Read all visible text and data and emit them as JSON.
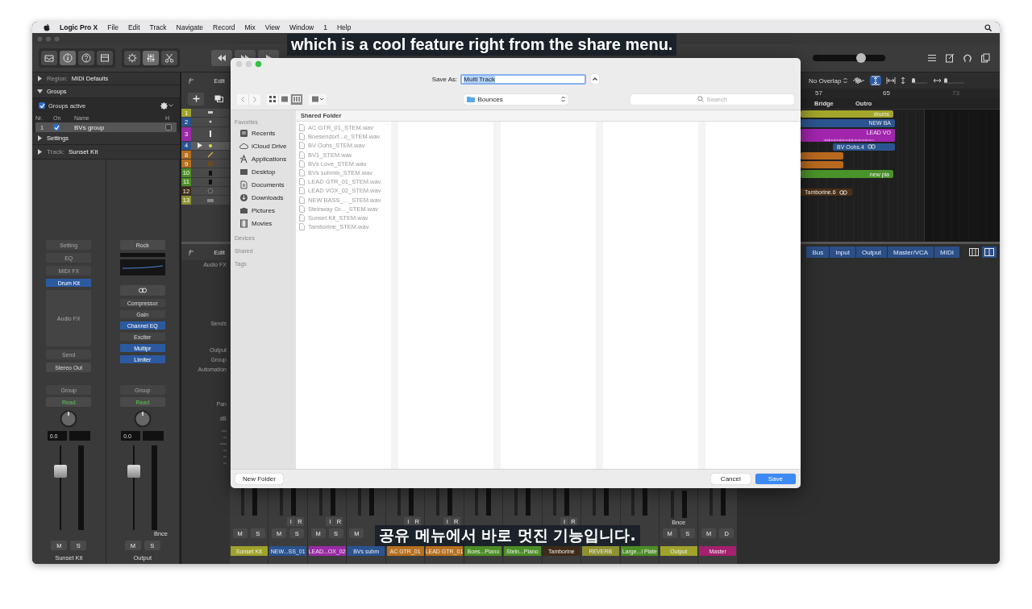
{
  "menu_bar": {
    "app": "Logic Pro X",
    "items": [
      "File",
      "Edit",
      "Track",
      "Navigate",
      "Record",
      "Mix",
      "View",
      "Window",
      "1",
      "Help"
    ]
  },
  "toolbar": {
    "master_volume": {
      "level": 0.67
    }
  },
  "inspector": {
    "region": {
      "label": "Region:",
      "value": "MIDI Defaults",
      "expanded": false
    },
    "groups": {
      "title": "Groups",
      "expanded": true,
      "active_label": "Groups active",
      "active": true,
      "columns": [
        "Nr.",
        "On",
        "Name",
        "H"
      ],
      "rows": [
        {
          "nr": "1",
          "on": true,
          "name": "BVs group",
          "hidden": false
        }
      ]
    },
    "settings": {
      "title": "Settings",
      "expanded": false
    },
    "track": {
      "label": "Track:",
      "value": "Sunset Kit",
      "expanded": false
    },
    "channel_strips": [
      {
        "slots": [
          {
            "kind": "slot",
            "text": "Setting",
            "disabled": true
          },
          {
            "kind": "slot",
            "text": "EQ",
            "disabled": true
          },
          {
            "kind": "slot",
            "text": "MIDI FX",
            "disabled": true
          },
          {
            "kind": "insert",
            "text": "Drum Kit",
            "on": true
          },
          {
            "kind": "area",
            "text": "Audio FX"
          },
          {
            "kind": "slot",
            "text": "Send",
            "disabled": true
          },
          {
            "kind": "slot",
            "text": "Stereo Out",
            "disabled": false
          }
        ],
        "group": "Group",
        "automation": "Read",
        "pan_value": "0.0",
        "fader": {
          "level": 0.7
        },
        "buttons": [
          "M",
          "S"
        ],
        "name": "Sunset Kit"
      },
      {
        "slots": [
          {
            "kind": "slot",
            "text": "Rock",
            "disabled": false
          },
          {
            "kind": "eq-display"
          },
          {
            "kind": "link"
          },
          {
            "kind": "insert",
            "text": "Compressor",
            "on": false
          },
          {
            "kind": "insert",
            "text": "Gain",
            "on": false
          },
          {
            "kind": "insert",
            "text": "Channel EQ",
            "on": true
          },
          {
            "kind": "insert",
            "text": "Exciter",
            "on": false
          },
          {
            "kind": "insert",
            "text": "Multipr",
            "on": true
          },
          {
            "kind": "insert",
            "text": "Limiter",
            "on": true
          }
        ],
        "group": "Group",
        "automation": "Read",
        "pan_value": "0.0",
        "fader": {
          "level": 0.7
        },
        "bounce": "Bnce",
        "buttons": [
          "M",
          "S"
        ],
        "name": "Output"
      }
    ]
  },
  "tracks": {
    "edit_label": "Edit",
    "rows": [
      {
        "number": "1",
        "color": "#9fa32a",
        "selected": false,
        "region": {
          "name": "drums",
          "color": "#a3a62b"
        }
      },
      {
        "number": "2",
        "color": "#2a5391",
        "selected": false,
        "region": {
          "name": "NEW BA",
          "color": "#2b5590"
        }
      },
      {
        "number": "3",
        "color": "#9b2aa6",
        "selected": false,
        "region": {
          "name": "LEAD VO",
          "color": "#a125ad"
        }
      },
      {
        "number": "4",
        "color": "#2a5391",
        "selected": true,
        "region": {
          "name": "BV Oohs.4",
          "color": "#2b5590"
        }
      },
      {
        "number": "8",
        "color": "#b8701f",
        "selected": false,
        "region": {
          "color": "#b8691f"
        }
      },
      {
        "number": "9",
        "color": "#b8701f",
        "selected": false,
        "region": {
          "color": "#b8691f"
        }
      },
      {
        "number": "10",
        "color": "#4c8f26",
        "selected": false,
        "region": {
          "name": "new pia",
          "color": "#4a922a"
        }
      },
      {
        "number": "11",
        "color": "#4c8f26",
        "selected": false
      },
      {
        "number": "12",
        "color": "#3e2a18",
        "selected": false,
        "region": {
          "name": "Tamborine.6",
          "color": "#4a3016"
        }
      },
      {
        "number": "13",
        "color": "#8d9130",
        "selected": false
      }
    ]
  },
  "arrange": {
    "drag_mode": "No Overlap",
    "ruler": [
      "57",
      "65",
      "73"
    ],
    "markers": [
      "Bridge",
      "Outro"
    ]
  },
  "mixer": {
    "edit_label": "Edit",
    "labels": [
      "Audio FX",
      "Sends",
      "Output",
      "Group",
      "Automation",
      "Pan",
      "dB"
    ],
    "filters": [
      {
        "label": "Bus",
        "on": true
      },
      {
        "label": "Input",
        "on": true
      },
      {
        "label": "Output",
        "on": true
      },
      {
        "label": "Master/VCA",
        "on": true
      },
      {
        "label": "MIDI",
        "on": true
      }
    ],
    "strips": [
      {
        "name": "Sunset Kit",
        "color": "#9fa32a",
        "buttons": [
          "M",
          "S"
        ]
      },
      {
        "name": "NEW...SS_01",
        "color": "#2a5391",
        "input": [
          "I",
          "R"
        ],
        "buttons": [
          "M",
          "S"
        ]
      },
      {
        "name": "LEAD...OX_02",
        "color": "#9b2aa6",
        "input": [
          "I",
          "R"
        ],
        "buttons": [
          "M",
          "S"
        ]
      },
      {
        "name": "BVs subm",
        "color": "#2a5391",
        "buttons": [
          "M"
        ]
      },
      {
        "name": "AC GTR_01",
        "color": "#b8701f",
        "input": [
          "I",
          "R"
        ]
      },
      {
        "name": "LEAD GTR_01",
        "color": "#b8701f",
        "input": [
          "I",
          "R"
        ]
      },
      {
        "name": "Boes...Piano",
        "color": "#4c8f26"
      },
      {
        "name": "Stein...Piano",
        "color": "#4c8f26"
      },
      {
        "name": "Tamborine",
        "color": "#3e2a18",
        "input": [
          "I",
          "R"
        ]
      },
      {
        "name": "REVERB",
        "color": "#8d9130"
      },
      {
        "name": "Large...l Plate",
        "color": "#4c8f26"
      },
      {
        "name": "Output",
        "color": "#9fa32a",
        "bounce": "Bnce",
        "buttons": [
          "M",
          "S"
        ]
      },
      {
        "name": "Master",
        "color": "#a5206f",
        "buttons": [
          "M",
          "D"
        ]
      }
    ]
  },
  "dialog": {
    "save_as_label": "Save As:",
    "file_name": "Multi Track",
    "location": "Bounces",
    "search_placeholder": "Search",
    "sidebar": [
      {
        "title": "Favorites",
        "items": [
          {
            "label": "Recents",
            "kind": "recents"
          },
          {
            "label": "iCloud Drive",
            "kind": "cloud"
          },
          {
            "label": "Applications",
            "kind": "applications"
          },
          {
            "label": "Desktop",
            "kind": "desktop"
          },
          {
            "label": "Documents",
            "kind": "documents"
          },
          {
            "label": "Downloads",
            "kind": "downloads"
          },
          {
            "label": "Pictures",
            "kind": "pictures"
          },
          {
            "label": "Movies",
            "kind": "movies"
          }
        ]
      },
      {
        "title": "Devices"
      },
      {
        "title": "Shared"
      },
      {
        "title": "Tags"
      }
    ],
    "column_header": "Shared Folder",
    "files": [
      {
        "name": "AC GTR_01_STEM.wav",
        "disabled": true
      },
      {
        "name": "Boesendorf...o_STEM.wav",
        "disabled": true
      },
      {
        "name": "BV Oohs_STEM.wav",
        "disabled": true
      },
      {
        "name": "BV1_STEM.wav",
        "disabled": true
      },
      {
        "name": "BVs Love_STEM.wav",
        "disabled": true
      },
      {
        "name": "BVs submix_STEM.wav",
        "disabled": true
      },
      {
        "name": "LEAD GTR_01_STEM.wav",
        "disabled": true
      },
      {
        "name": "LEAD VOX_02_STEM.wav",
        "disabled": true
      },
      {
        "name": "NEW BASS_..._STEM.wav",
        "disabled": true
      },
      {
        "name": "Steinway Gr..._STEM.wav",
        "disabled": true
      },
      {
        "name": "Sunset Kit_STEM.wav",
        "disabled": true
      },
      {
        "name": "Tamborine_STEM.wav",
        "disabled": true
      }
    ],
    "buttons": {
      "new_folder": "New Folder",
      "cancel": "Cancel",
      "save": "Save"
    }
  },
  "captions": [
    "which is a cool feature right from the share menu.",
    "공유 메뉴에서 바로 멋진 기능입니다."
  ]
}
